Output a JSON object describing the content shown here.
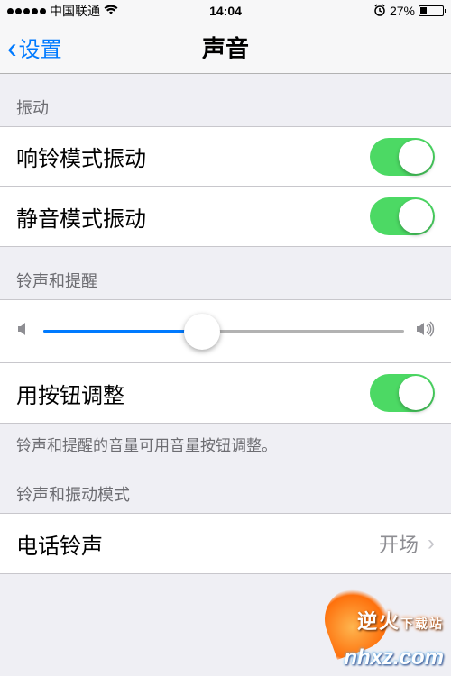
{
  "status": {
    "carrier": "中国联通",
    "time": "14:04",
    "battery_pct": "27%"
  },
  "nav": {
    "back_label": "设置",
    "title": "声音"
  },
  "sections": {
    "vibrate": {
      "header": "振动",
      "vibrate_on_ring": {
        "label": "响铃模式振动",
        "on": true
      },
      "vibrate_on_silent": {
        "label": "静音模式振动",
        "on": true
      }
    },
    "ringer": {
      "header": "铃声和提醒",
      "volume_pct": 44,
      "change_with_buttons": {
        "label": "用按钮调整",
        "on": true
      },
      "footer": "铃声和提醒的音量可用音量按钮调整。"
    },
    "patterns": {
      "header": "铃声和振动模式",
      "ringtone": {
        "label": "电话铃声",
        "value": "开场"
      }
    }
  },
  "watermark": {
    "brand": "逆火",
    "sub": "下载站",
    "url": "nhxz.com"
  }
}
